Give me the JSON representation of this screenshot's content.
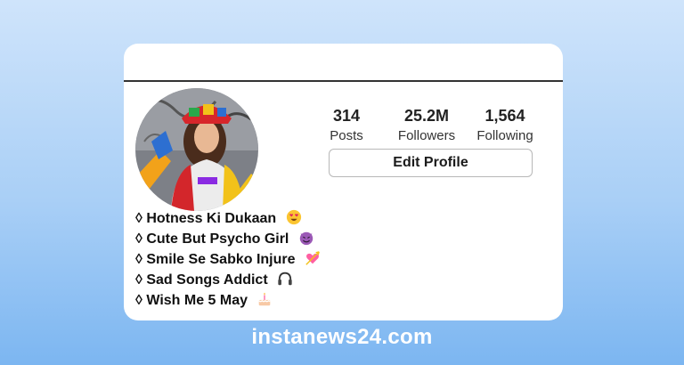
{
  "profile": {
    "stats": [
      {
        "value": "314",
        "label": "Posts"
      },
      {
        "value": "25.2M",
        "label": "Followers"
      },
      {
        "value": "1,564",
        "label": "Following"
      }
    ],
    "edit_button_label": "Edit Profile",
    "bio_lines": [
      {
        "text": "◊ Hotness Ki Dukaan",
        "icon": "heart-eyes-emoji-icon"
      },
      {
        "text": "◊ Cute But Psycho Girl",
        "icon": "devil-emoji-icon"
      },
      {
        "text": "◊ Smile Se Sabko Injure",
        "icon": "heart-arrow-emoji-icon"
      },
      {
        "text": "◊ Sad Songs Addict",
        "icon": "headphones-emoji-icon"
      },
      {
        "text": "◊ Wish Me 5 May",
        "icon": "cake-emoji-icon"
      }
    ]
  },
  "footer": {
    "site": "instanews24.com"
  },
  "colors": {
    "background_top": "#cfe4fb",
    "background_bottom": "#7cb6f1",
    "card": "#ffffff"
  }
}
